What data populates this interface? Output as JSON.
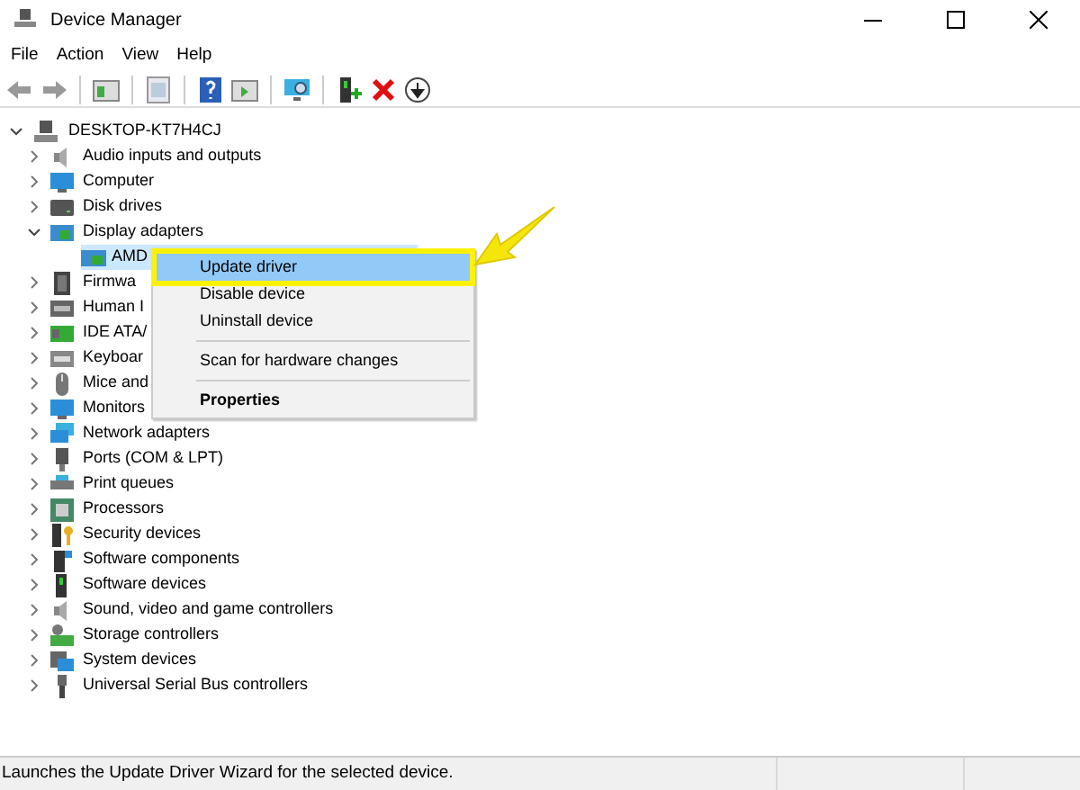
{
  "window": {
    "title": "Device Manager"
  },
  "menu_bar": [
    "File",
    "Action",
    "View",
    "Help"
  ],
  "tree": {
    "label": "DESKTOP-KT7H4CJ",
    "expanded": true,
    "children": [
      {
        "label": "Audio inputs and outputs",
        "expanded": false
      },
      {
        "label": "Computer",
        "expanded": false
      },
      {
        "label": "Disk drives",
        "expanded": false
      },
      {
        "label": "Display adapters",
        "expanded": true,
        "children": [
          {
            "label": "AMD",
            "selected": true
          }
        ]
      },
      {
        "label": "Firmwa",
        "expanded": false
      },
      {
        "label": "Human I",
        "expanded": false
      },
      {
        "label": "IDE ATA/",
        "expanded": false
      },
      {
        "label": "Keyboar",
        "expanded": false
      },
      {
        "label": "Mice and",
        "expanded": false
      },
      {
        "label": "Monitors",
        "expanded": false
      },
      {
        "label": "Network adapters",
        "expanded": false
      },
      {
        "label": "Ports (COM & LPT)",
        "expanded": false
      },
      {
        "label": "Print queues",
        "expanded": false
      },
      {
        "label": "Processors",
        "expanded": false
      },
      {
        "label": "Security devices",
        "expanded": false
      },
      {
        "label": "Software components",
        "expanded": false
      },
      {
        "label": "Software devices",
        "expanded": false
      },
      {
        "label": "Sound, video and game controllers",
        "expanded": false
      },
      {
        "label": "Storage controllers",
        "expanded": false
      },
      {
        "label": "System devices",
        "expanded": false
      },
      {
        "label": "Universal Serial Bus controllers",
        "expanded": false
      }
    ]
  },
  "context_menu": [
    {
      "kind": "item",
      "label": "Update driver",
      "selected": true,
      "bold": false
    },
    {
      "kind": "item",
      "label": "Disable device",
      "selected": false,
      "bold": false
    },
    {
      "kind": "item",
      "label": "Uninstall device",
      "selected": false,
      "bold": false
    },
    {
      "kind": "separator"
    },
    {
      "kind": "item",
      "label": "Scan for hardware changes",
      "selected": false,
      "bold": false
    },
    {
      "kind": "separator"
    },
    {
      "kind": "item",
      "label": "Properties",
      "selected": false,
      "bold": true
    }
  ],
  "status_bar": {
    "text": "Launches the Update Driver Wizard for the selected device."
  }
}
